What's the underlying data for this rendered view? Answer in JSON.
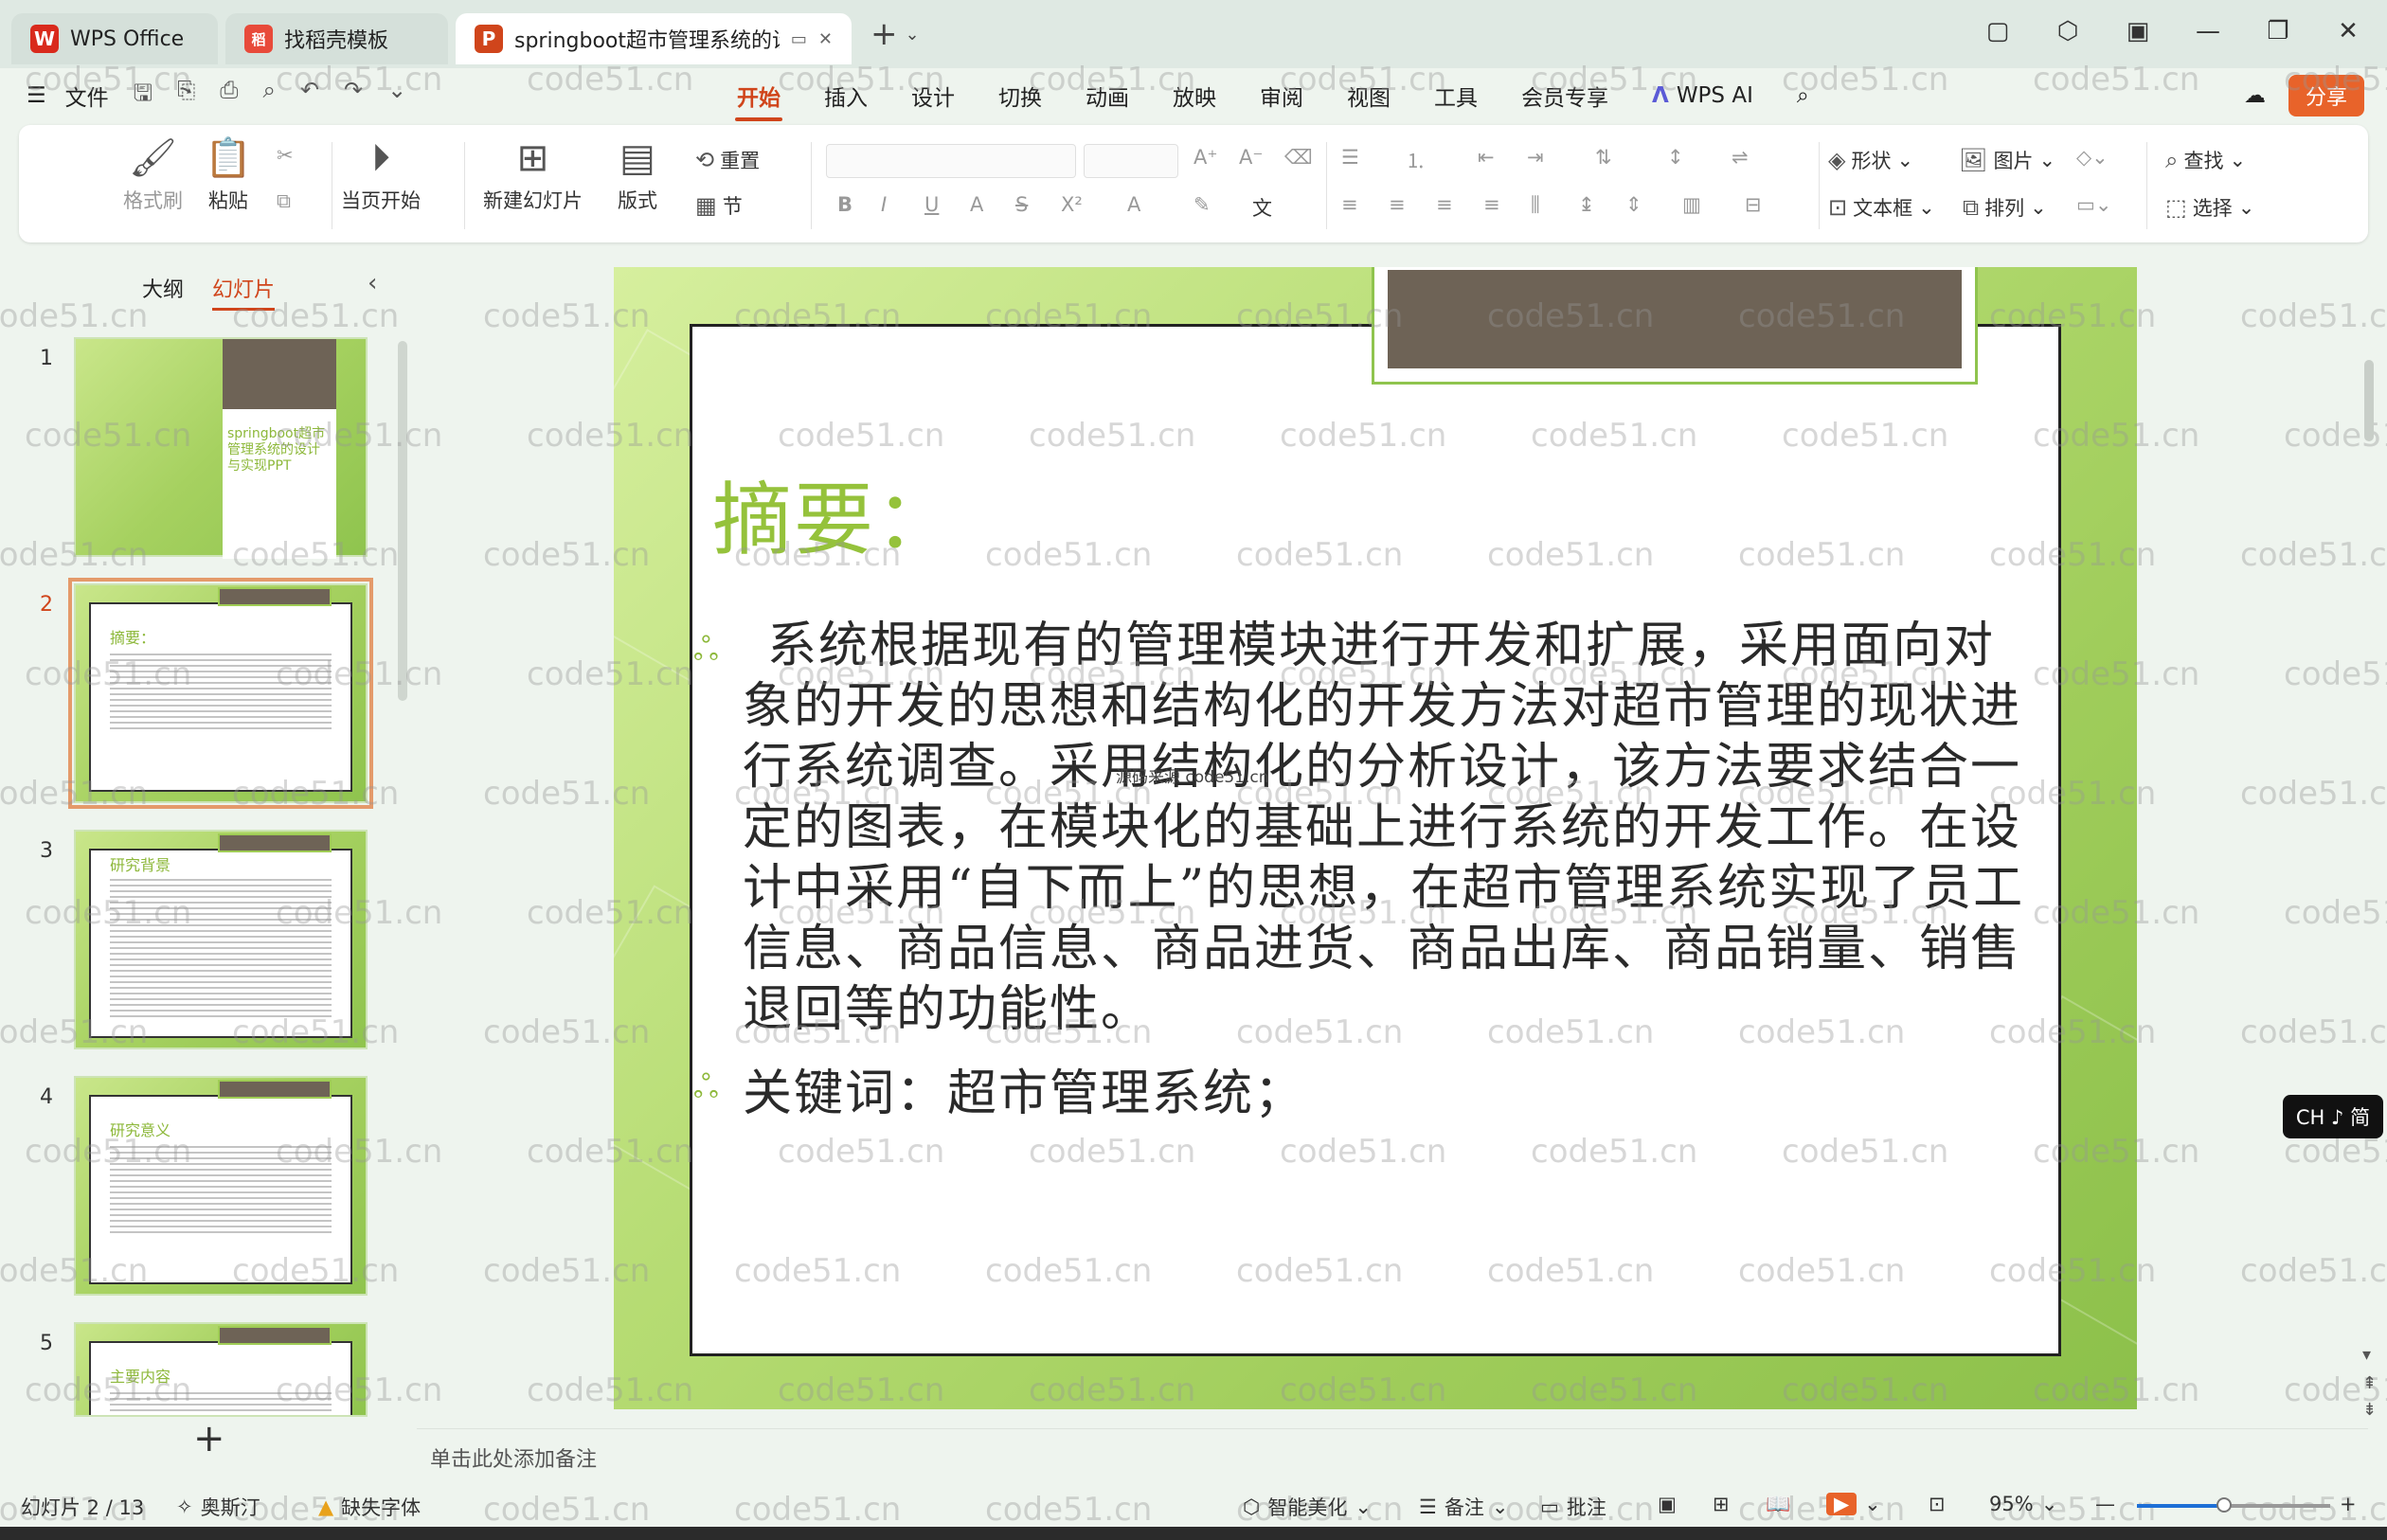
{
  "titlebar": {
    "tabs": [
      {
        "label": "WPS Office",
        "logo": "W"
      },
      {
        "label": "找稻壳模板",
        "logo": "稻"
      },
      {
        "label": "springboot超市管理系统的设",
        "logo": "P"
      }
    ],
    "new_tab": "+"
  },
  "menubar": {
    "file_label": "文件",
    "tabs": [
      "开始",
      "插入",
      "设计",
      "切换",
      "动画",
      "放映",
      "审阅",
      "视图",
      "工具",
      "会员专享"
    ],
    "active_tab": "开始",
    "wps_ai": "WPS AI",
    "share": "分享"
  },
  "ribbon": {
    "format_painter": "格式刷",
    "paste": "粘贴",
    "start_from_current": "当页开始",
    "new_slide": "新建幻灯片",
    "layout": "版式",
    "reset": "重置",
    "section": "节",
    "shape": "形状",
    "picture": "图片",
    "find": "查找",
    "textbox": "文本框",
    "arrange": "排列",
    "select": "选择"
  },
  "leftpane": {
    "tab_outline": "大纲",
    "tab_slides": "幻灯片",
    "thumbnails": [
      {
        "num": "1",
        "title": "springboot超市管理系统的设计与实现PPT"
      },
      {
        "num": "2",
        "title": "摘要："
      },
      {
        "num": "3",
        "title": "研究背景"
      },
      {
        "num": "4",
        "title": "研究意义"
      },
      {
        "num": "5",
        "title": "主要内容"
      }
    ],
    "selected": "2"
  },
  "slide": {
    "title": "摘要：",
    "body": "系统根据现有的管理模块进行开发和扩展，采用面向对象的开发的思想和结构化的开发方法对超市管理的现状进行系统调查。采用结构化的分析设计，该方法要求结合一定的图表，在模块化的基础上进行系统的开发工作。在设计中采用“自下而上”的思想，在超市管理系统实现了员工信息、商品信息、商品进货、商品出库、商品销量、销售退回等的功能性。",
    "keywords": "关键词：超市管理系统；",
    "caption": "源码来源 code51.cn"
  },
  "watermark": "code51.cn",
  "notes_placeholder": "单击此处添加备注",
  "statusbar": {
    "slide_counter": "幻灯片 2 / 13",
    "theme": "奥斯汀",
    "missing_font": "缺失字体",
    "smart_beautify": "智能美化",
    "notes": "备注",
    "comments": "批注",
    "zoom": "95%"
  },
  "ime": "CH ♪ 简",
  "colors": {
    "accent": "#d0451b",
    "slide_green": "#95c23b",
    "dark_block": "#6e6356",
    "share_orange": "#e8632a"
  }
}
